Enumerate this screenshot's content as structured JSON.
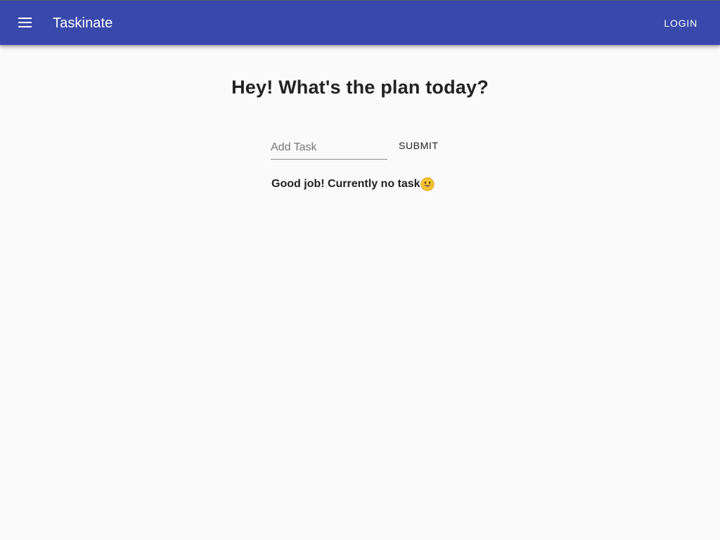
{
  "appbar": {
    "title": "Taskinate",
    "menu_icon": "hamburger-menu-icon",
    "login_label": "LOGIN",
    "background_color": "#3949ab"
  },
  "main": {
    "headline": "Hey! What's the plan today?",
    "task_input": {
      "placeholder": "Add Task",
      "value": ""
    },
    "submit_label": "SUBMIT",
    "empty_message": "Good job! Currently no task",
    "empty_message_icon": "smiley-face-icon"
  }
}
